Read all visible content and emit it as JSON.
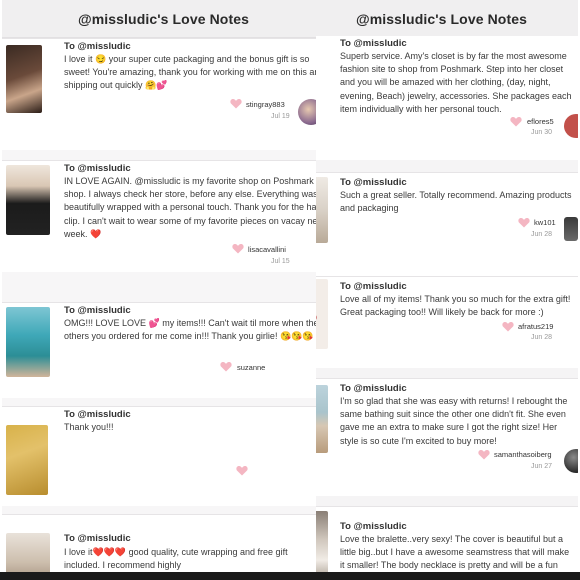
{
  "left_panel": {
    "title": "@missludic's Love Notes",
    "notes": [
      {
        "to": "To @missludic",
        "message": "I love it 😏 your super cute packaging and the bonus gift is so sweet! You're amazing, thank you for working with me on this and shipping out quickly 🤗💕",
        "username": "stingray883",
        "date": "Jul 19"
      },
      {
        "to": "To @missludic",
        "message": "IN LOVE AGAIN. @missludic is my favorite shop on Poshmark to shop. I always check her store, before any else. Everything was beautifully wrapped with a personal touch. Thank you for the hair clip. I can't wait to wear some of my favorite pieces on vacay next week. ❤️",
        "username": "lisacavallini",
        "date": "Jul 15"
      },
      {
        "to": "To @missludic",
        "message": "OMG!!! LOVE LOVE 💕 my items!!! Can't wait til more when the others you ordered for me come in!!! Thank you girlie! 😘😘😘",
        "username": "suzanne",
        "date": ""
      },
      {
        "to": "To @missludic",
        "message": "Thank you!!!",
        "username": "",
        "date": ""
      },
      {
        "to": "To @missludic",
        "message": "I love it❤️❤️❤️ good quality, cute wrapping and free gift included. I recommend highly",
        "username": "",
        "date": ""
      }
    ]
  },
  "right_panel": {
    "title": "@missludic's Love Notes",
    "notes": [
      {
        "to": "To @missludic",
        "message": "Superb service. Amy's closet is by far the most awesome fashion site to shop from Poshmark. Step into her closet and you will be amazed with her clothing, (day, night, evening, Beach) jewelry, accessories. She packages each item individually with her personal touch.",
        "username": "eflores5",
        "date": "Jun 30"
      },
      {
        "to": "To @missludic",
        "message": "Such a great seller. Totally recommend. Amazing products and packaging",
        "username": "kw101",
        "date": "Jun 28"
      },
      {
        "to": "To @missludic",
        "message": "Love all of my items! Thank you so much for the extra gift! Great packaging too!! Will likely be back for more :)",
        "username": "afratus219",
        "date": "Jun 28"
      },
      {
        "to": "To @missludic",
        "message": "I'm so glad that she was easy with returns! I rebought the same bathing suit since the other one didn't fit. She even gave me an extra to make sure I got the right size! Her style is so cute I'm excited to buy more!",
        "username": "samanthasoiberg",
        "date": "Jun 27"
      },
      {
        "to": "To @missludic",
        "message": "Love the bralette..very sexy! The cover is beautiful but a little big..but I have a awesome seamstress that will make it smaller! The body necklace is pretty and will be a fun Bachelorette gift! Thanks again",
        "username": "",
        "date": ""
      }
    ]
  },
  "colors": {
    "heart": "#f4b6c2",
    "accent_avatar": "#c2504a"
  }
}
